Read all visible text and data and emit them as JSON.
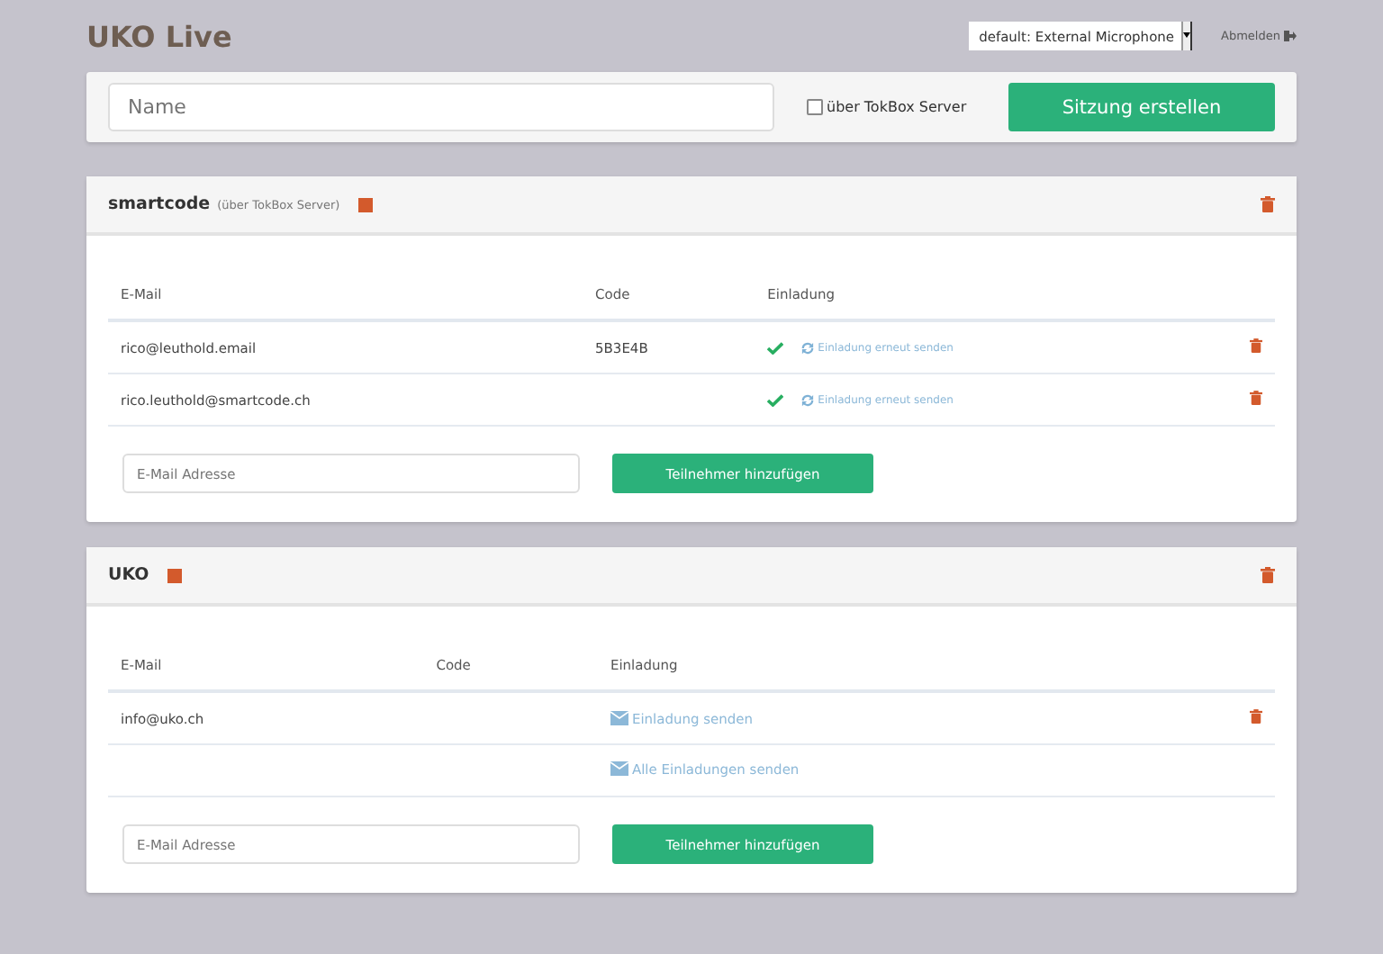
{
  "header": {
    "title": "UKO Live",
    "microphone_select": "default: External Microphone",
    "logout_link": "Abmelden"
  },
  "create_session": {
    "name_placeholder": "Name",
    "tokbox_label": "über TokBox Server",
    "tokbox_checked": false,
    "create_button": "Sitzung erstellen"
  },
  "sessions": [
    {
      "name": "smartcode",
      "note": "(über TokBox Server)",
      "columns": [
        "E-Mail",
        "Code",
        "Einladung"
      ],
      "participants": [
        {
          "email": "rico@leuthold.email",
          "code": "5B3E4B",
          "invited": true,
          "invite_link": "Einladung erneut senden"
        },
        {
          "email": "rico.leuthold@smartcode.ch",
          "invited": true,
          "invite_link": "Einladung erneut senden"
        }
      ],
      "email_placeholder": "E-Mail Adresse",
      "add_button": "Teilnehmer hinzufügen"
    },
    {
      "name": "UKO",
      "columns": [
        "E-Mail",
        "Code",
        "Einladung"
      ],
      "participants": [
        {
          "email": "info@uko.ch",
          "invited": false,
          "invite_link": "Einladung senden"
        }
      ],
      "send_all_link": "Alle Einladungen senden",
      "email_placeholder": "E-Mail Adresse",
      "add_button": "Teilnehmer hinzufügen"
    }
  ]
}
